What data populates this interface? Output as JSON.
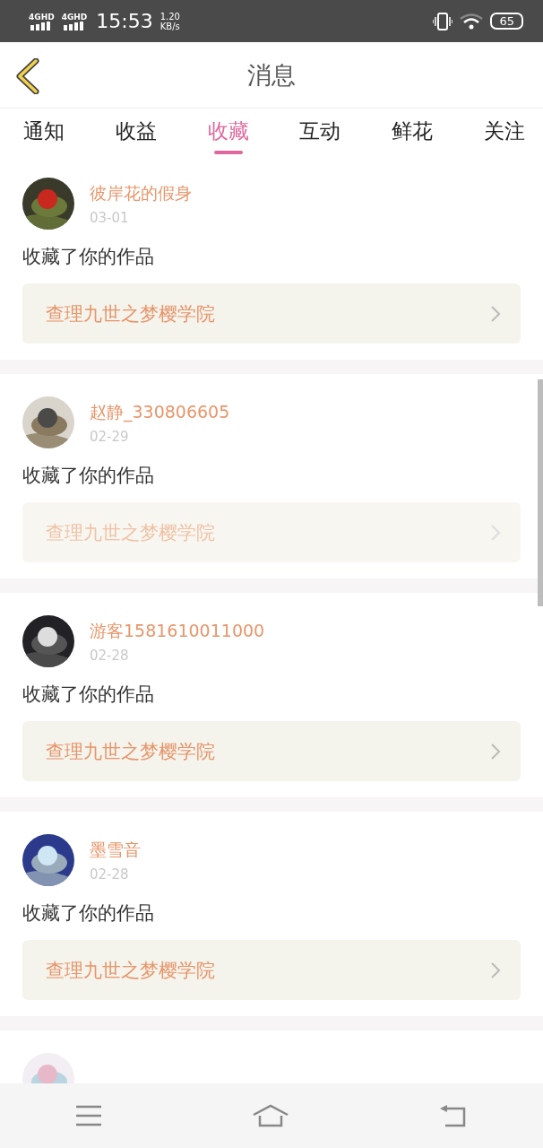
{
  "status_bar": {
    "network_1": "4GHD",
    "network_2": "4GHD",
    "time": "15:53",
    "speed_value": "1.20",
    "speed_unit": "KB/s",
    "battery": "65"
  },
  "header": {
    "title": "消息"
  },
  "tabs": [
    {
      "label": "通知",
      "selected": false
    },
    {
      "label": "收益",
      "selected": false
    },
    {
      "label": "收藏",
      "selected": true
    },
    {
      "label": "互动",
      "selected": false
    },
    {
      "label": "鲜花",
      "selected": false
    },
    {
      "label": "关注",
      "selected": false
    }
  ],
  "messages": [
    {
      "user": "彼岸花的假身",
      "date": "03-01",
      "text": "收藏了你的作品",
      "work": "查理九世之梦樱学院",
      "dimmed": false,
      "avatar": {
        "kind": "picture"
      }
    },
    {
      "user": "赵静_330806605",
      "date": "02-29",
      "text": "收藏了你的作品",
      "work": "查理九世之梦樱学院",
      "dimmed": true,
      "avatar": {
        "kind": "picture"
      }
    },
    {
      "user": "游客1581610011000",
      "date": "02-28",
      "text": "收藏了你的作品",
      "work": "查理九世之梦樱学院",
      "dimmed": false,
      "avatar": {
        "kind": "picture"
      }
    },
    {
      "user": "墨雪音",
      "date": "02-28",
      "text": "收藏了你的作品",
      "work": "查理九世之梦樱学院",
      "dimmed": false,
      "avatar": {
        "kind": "picture"
      }
    },
    {
      "avatar": {
        "kind": "picture"
      }
    }
  ]
}
